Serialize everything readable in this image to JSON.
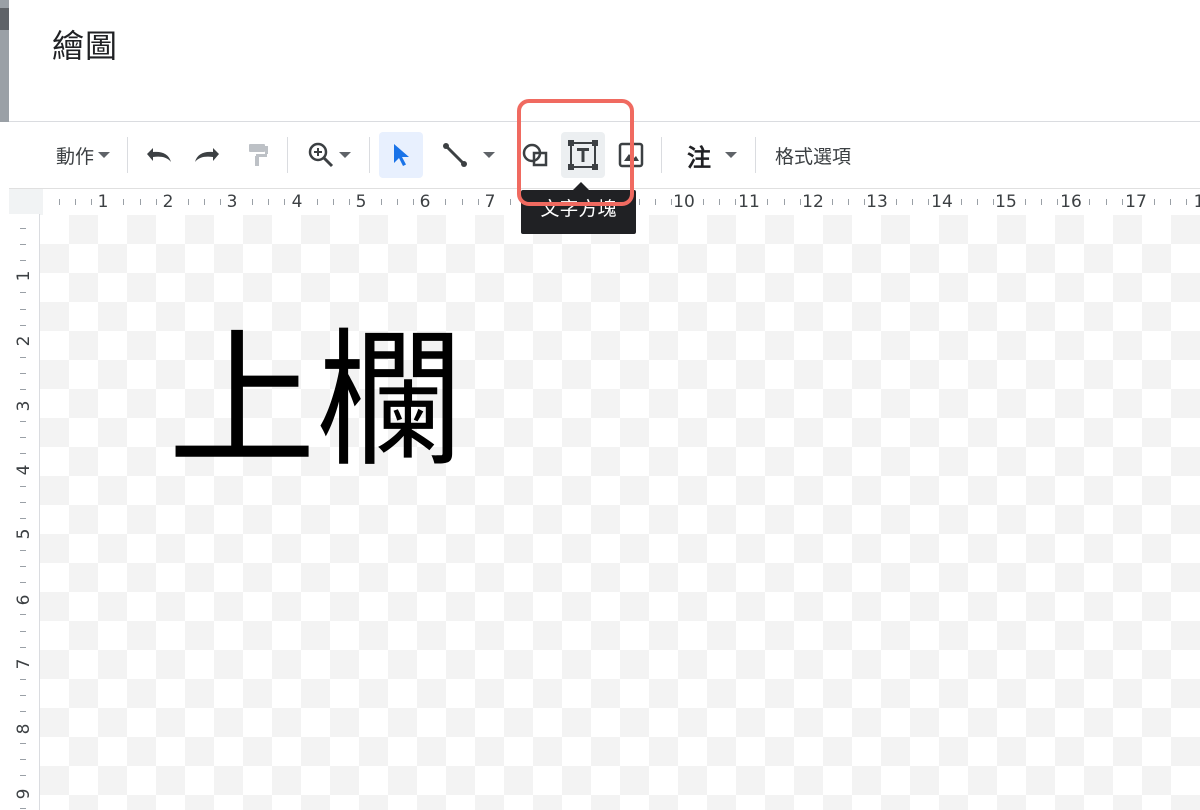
{
  "window": {
    "title": "繪圖"
  },
  "toolbar": {
    "actions_label": "動作",
    "format_options_label": "格式選項",
    "annotation_label": "注",
    "tooltip": "文字方塊"
  },
  "ruler": {
    "horizontal": [
      "1",
      "2",
      "3",
      "4",
      "5",
      "6",
      "7",
      "10",
      "11",
      "12",
      "13",
      "14",
      "15",
      "16",
      "17",
      "1"
    ],
    "vertical": [
      "1",
      "2",
      "3",
      "4",
      "5",
      "6",
      "7",
      "8",
      "9"
    ]
  },
  "canvas": {
    "text": "上欄"
  },
  "colors": {
    "highlight": "#f06a60",
    "accent": "#1a73e8",
    "tooltip_bg": "#202124"
  }
}
